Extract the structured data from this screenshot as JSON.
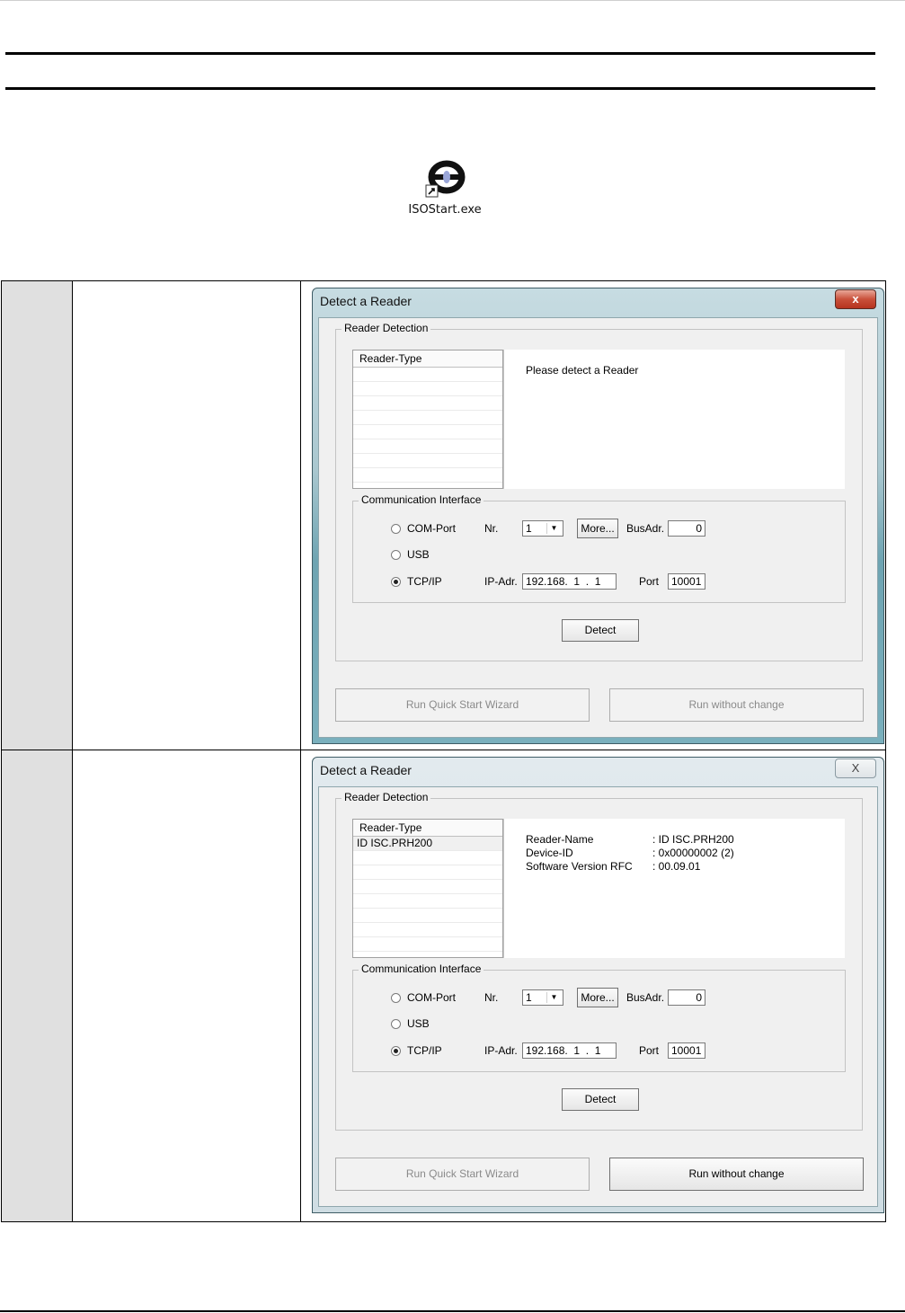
{
  "icon": {
    "label": "ISOStart.exe",
    "name": "isostart-app-icon"
  },
  "steps": [
    {
      "window": {
        "title": "Detect a Reader",
        "close_label": "x",
        "group_label": "Reader Detection",
        "list_header": "Reader-Type",
        "list_items": [],
        "message": "Please detect a Reader",
        "comm": {
          "label": "Communication Interface",
          "com_port": "COM-Port",
          "nr_label": "Nr.",
          "nr_value": "1",
          "more": "More...",
          "busadr_label": "BusAdr.",
          "busadr_value": "0",
          "usb": "USB",
          "tcpip": "TCP/IP",
          "ip_label": "IP-Adr.",
          "ip_value": "192.168.  1  .  1",
          "port_label": "Port",
          "port_value": "10001",
          "selected": "TCP/IP"
        },
        "detect": "Detect",
        "run_wizard": "Run Quick Start Wizard",
        "run_without": "Run without change"
      }
    },
    {
      "window": {
        "title": "Detect a Reader",
        "close_label": "X",
        "group_label": "Reader Detection",
        "list_header": "Reader-Type",
        "list_items": [
          "ID ISC.PRH200"
        ],
        "info": {
          "reader_name_label": "Reader-Name",
          "reader_name_value": ": ID ISC.PRH200",
          "device_id_label": "Device-ID",
          "device_id_value": ": 0x00000002 (2)",
          "sw_label": "Software Version RFC",
          "sw_value": ": 00.09.01"
        },
        "comm": {
          "label": "Communication Interface",
          "com_port": "COM-Port",
          "nr_label": "Nr.",
          "nr_value": "1",
          "more": "More...",
          "busadr_label": "BusAdr.",
          "busadr_value": "0",
          "usb": "USB",
          "tcpip": "TCP/IP",
          "ip_label": "IP-Adr.",
          "ip_value": "192.168.  1  .  1",
          "port_label": "Port",
          "port_value": "10001",
          "selected": "TCP/IP"
        },
        "detect": "Detect",
        "run_wizard": "Run Quick Start Wizard",
        "run_without": "Run without change"
      }
    }
  ]
}
